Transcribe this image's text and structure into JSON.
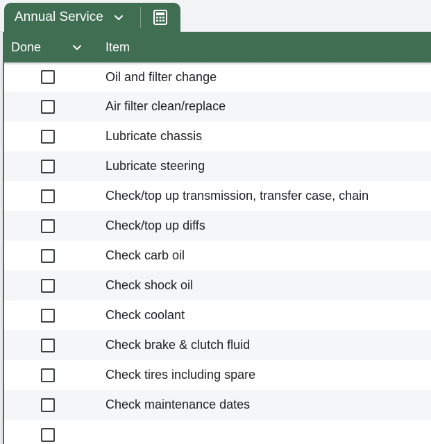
{
  "tab": {
    "title": "Annual Service",
    "icons": [
      "chevron-down-icon",
      "calculator-icon"
    ]
  },
  "header": {
    "done_label": "Done",
    "item_label": "Item"
  },
  "rows": [
    {
      "done": false,
      "item": "Oil and filter change"
    },
    {
      "done": false,
      "item": "Air filter clean/replace"
    },
    {
      "done": false,
      "item": "Lubricate chassis"
    },
    {
      "done": false,
      "item": "Lubricate steering"
    },
    {
      "done": false,
      "item": "Check/top up transmission, transfer case, chain"
    },
    {
      "done": false,
      "item": "Check/top up diffs"
    },
    {
      "done": false,
      "item": "Check carb oil"
    },
    {
      "done": false,
      "item": "Check shock oil"
    },
    {
      "done": false,
      "item": "Check coolant"
    },
    {
      "done": false,
      "item": "Check brake & clutch fluid"
    },
    {
      "done": false,
      "item": "Check tires including spare"
    },
    {
      "done": false,
      "item": "Check maintenance dates"
    },
    {
      "done": false,
      "item": ""
    }
  ],
  "colors": {
    "accent": "#3f6e52",
    "alt_row": "#f4f6f8",
    "text": "#202124"
  }
}
